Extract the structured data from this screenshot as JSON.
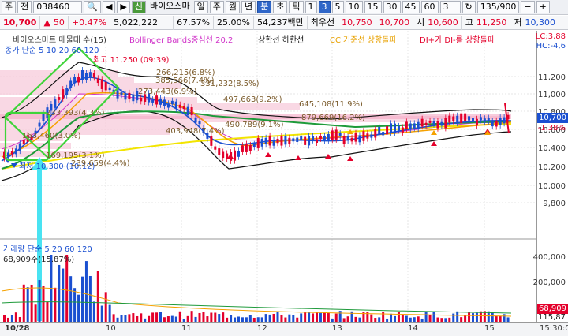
{
  "toolbar": {
    "code": "038460",
    "mode1": "주",
    "mode2": "전",
    "prev": "◀",
    "next": "▶",
    "badge": "신",
    "name": "바이오스마",
    "periods": [
      "일",
      "주",
      "월",
      "년",
      "분",
      "초",
      "틱"
    ],
    "intervals": [
      "1",
      "3",
      "5",
      "10",
      "15",
      "30",
      "45",
      "60"
    ],
    "active_period_index": 4,
    "active_interval_index": 1,
    "interval_value": "3",
    "count": "135/900"
  },
  "quote": {
    "price": "10,700",
    "change_arrow": "▲",
    "change": "50",
    "change_pct": "+0.47%",
    "volume": "5,022,222",
    "ratio1": "67.57%",
    "ratio2": "25.00%",
    "amount": "54,237백만",
    "fund_label": "최우선",
    "bid1": "10,750",
    "bid2": "10,700",
    "open_label": "시",
    "open": "10,600",
    "high_label": "고",
    "high": "11,250",
    "low_label": "저",
    "low": "10,300"
  },
  "legend": {
    "title": "바이오스마트 매물대 수(15)",
    "bollinger": "Bollinger Bands중심선 20,2",
    "bands": "상한선  하한선",
    "cci": "CCI기준선 상향돌파",
    "dmi": "DI+가 DI-를 상향돌파",
    "ma": "종가 단순 5  10  20  60  120",
    "lc": "LC:3,88",
    "hc": "HC:-4,6",
    "high_note": "최고 11,250 (09:39)",
    "low_note": "최저 10,300 (10:12)"
  },
  "volume_profile_labels": [
    "266,215(6.8%)",
    "385,566(7.4%)",
    "331,232(8.5%)",
    "273,443(6.9%)",
    "497,663(9.2%)",
    "645,108(11.9%)",
    "233,393(4.3%)",
    "879,669(16.2%)",
    "490,789(9.1%)",
    "403,948(7.4%)",
    "163,460(3.0%)",
    "169,195(3.1%)",
    "239,659(4.4%)"
  ],
  "volume_legend": {
    "title": "거래량 단순 5  20  60  120",
    "value": "68,909주(15.87%)"
  },
  "y_ticks": [
    "11,200",
    "11,000",
    "10,800",
    "10,600",
    "10,400",
    "10,200",
    "10,000",
    "9,800"
  ],
  "y_current": "10,700",
  "y_current_pct": "-1.38%",
  "vol_ticks": [
    "400,000",
    "200,000"
  ],
  "vol_current": "68,909",
  "vol_current2": "115,87",
  "x_ticks": [
    "10/28",
    "10",
    "11",
    "12",
    "13",
    "14",
    "15",
    "15:30:0"
  ],
  "colors": {
    "up": "#e4002b",
    "down": "#1a4fd0",
    "accent": "#2f66c8"
  }
}
